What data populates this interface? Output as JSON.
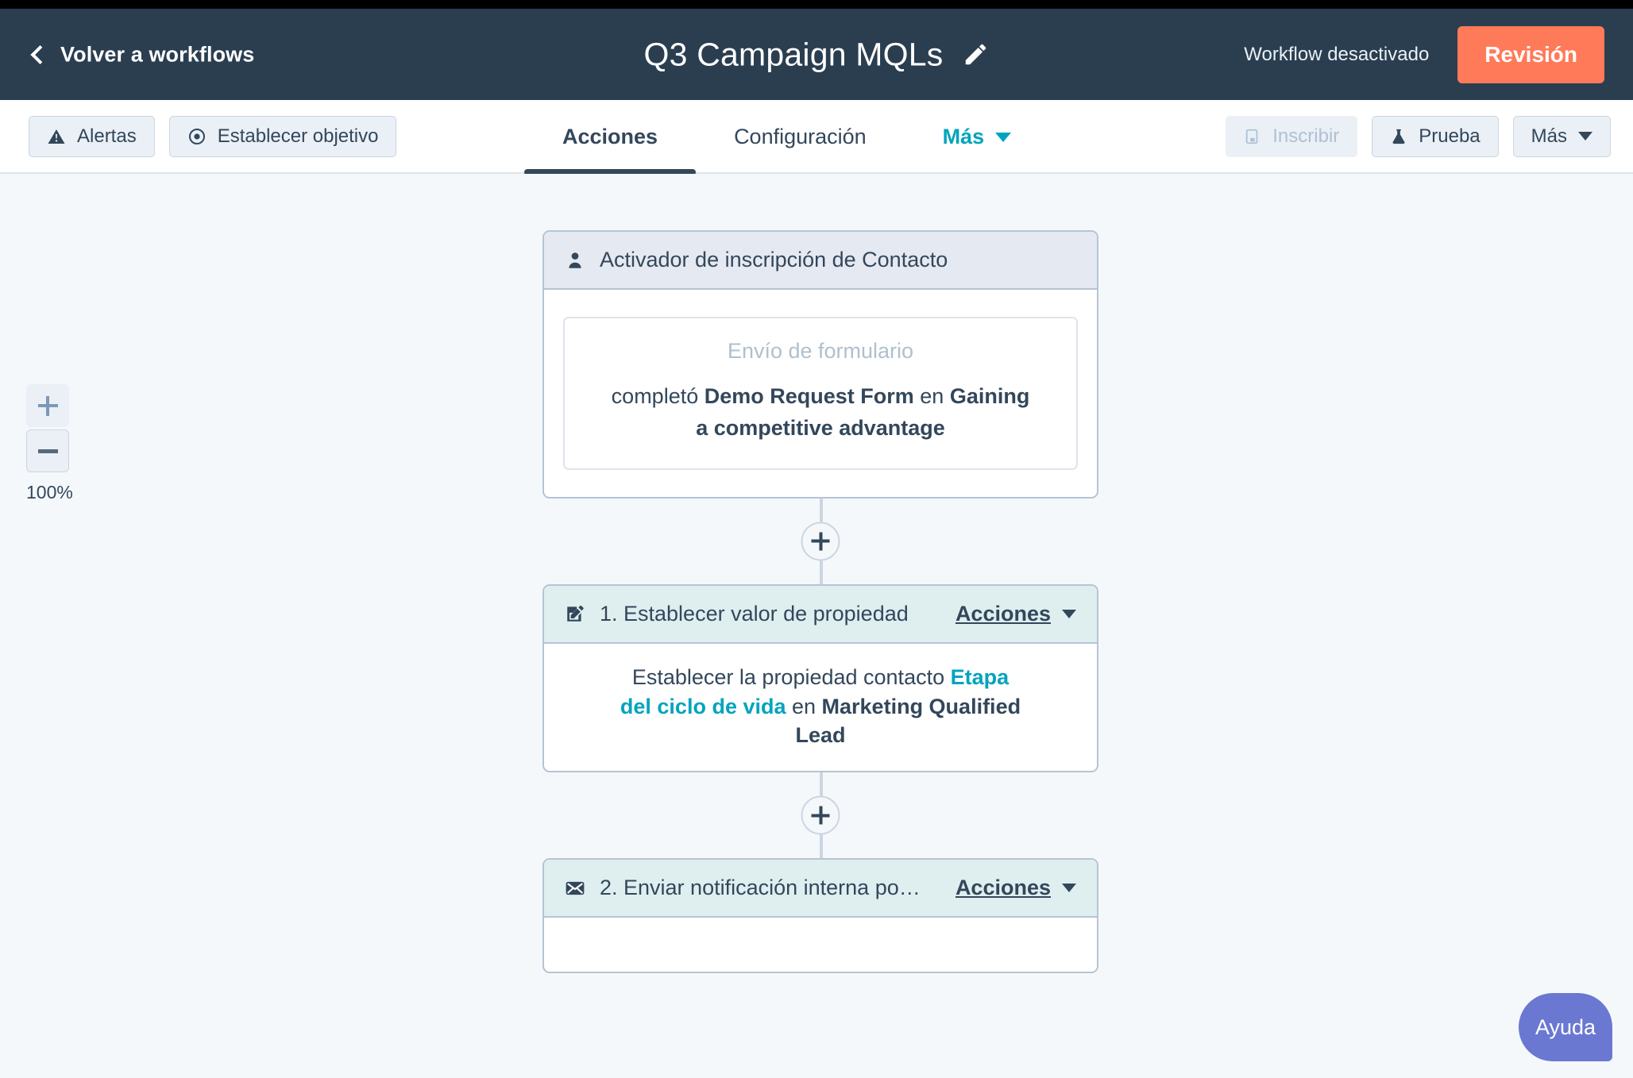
{
  "topbar": {
    "back_label": "Volver a workflows",
    "title": "Q3 Campaign MQLs",
    "edit_icon": "pencil-icon",
    "status": "Workflow desactivado",
    "review_button": "Revisión",
    "background_color": "#2A3E50",
    "review_color": "#FF7A59"
  },
  "toolbar": {
    "left_buttons": [
      {
        "label": "Alertas",
        "icon": "alert-triangle-icon",
        "disabled": false
      },
      {
        "label": "Establecer objetivo",
        "icon": "target-icon",
        "disabled": false
      }
    ],
    "tabs": [
      {
        "label": "Acciones",
        "active": true,
        "dropdown": false
      },
      {
        "label": "Configuración",
        "active": false,
        "dropdown": false
      },
      {
        "label": "Más",
        "active": false,
        "dropdown": true,
        "color": "#00A4BD"
      }
    ],
    "right_buttons": [
      {
        "label": "Inscribir",
        "icon": "enroll-icon",
        "disabled": true,
        "dropdown": false
      },
      {
        "label": "Prueba",
        "icon": "flask-icon",
        "disabled": false,
        "dropdown": false
      },
      {
        "label": "Más",
        "icon": "",
        "disabled": false,
        "dropdown": true
      }
    ]
  },
  "zoom_controls": {
    "zoom_in_icon": "plus-icon",
    "zoom_out_icon": "minus-icon",
    "level": "100%"
  },
  "flow": {
    "trigger": {
      "icon": "contact-person-icon",
      "title": "Activador de inscripción de Contacto",
      "criterion": {
        "label": "Envío de formulario",
        "text_prefix": "completó ",
        "form_name": "Demo Request Form",
        "text_middle": " en ",
        "page_name": "Gaining a competitive advantage"
      }
    },
    "steps": [
      {
        "icon": "edit-property-icon",
        "title": "1. Establecer valor de propiedad",
        "actions_label": "Acciones",
        "body": {
          "prefix": "Establecer la propiedad contacto ",
          "property_link": "Etapa del ciclo de vida",
          "middle": " en ",
          "value": "Marketing Qualified Lead"
        }
      },
      {
        "icon": "envelope-icon",
        "title": "2. Enviar notificación interna po…",
        "actions_label": "Acciones",
        "body": null
      }
    ],
    "add_step_icon": "plus-icon"
  },
  "help": {
    "label": "Ayuda",
    "color": "#6A78D1"
  }
}
